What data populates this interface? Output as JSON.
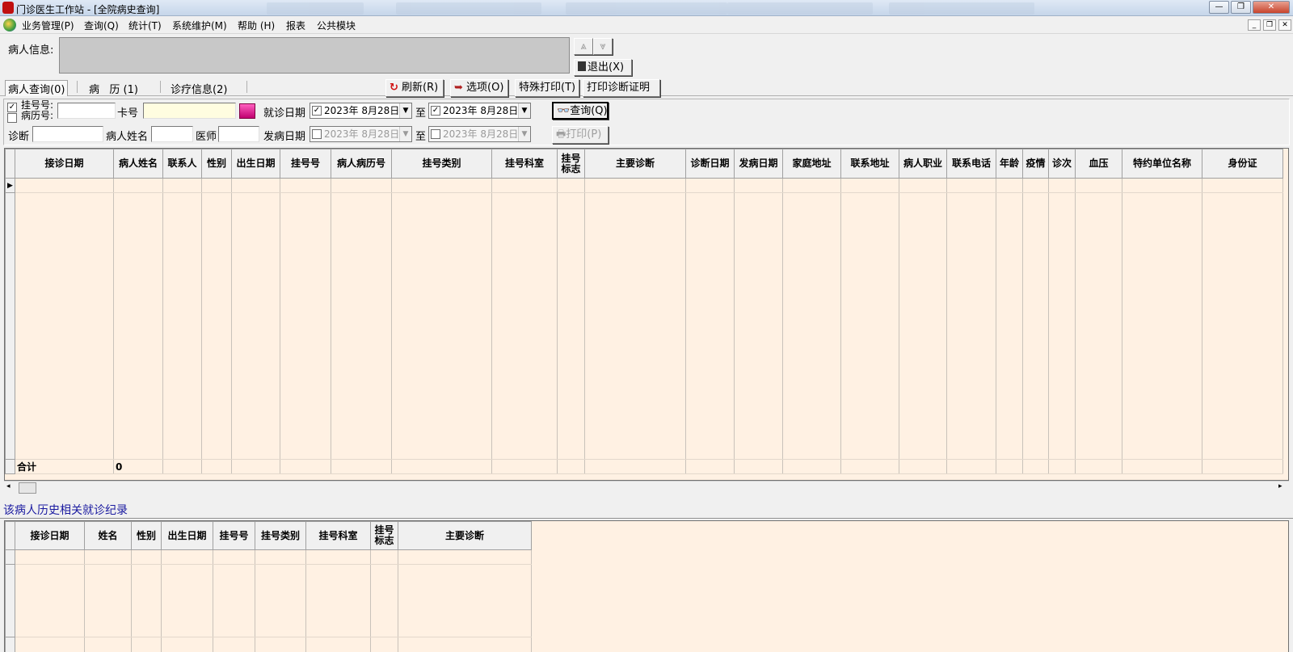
{
  "window": {
    "title": "门诊医生工作站 - [全院病史查询]"
  },
  "menu": [
    "业务管理(P)",
    "查询(Q)",
    "统计(T)",
    "系统维护(M)",
    "帮助 (H)",
    "报表",
    "公共模块"
  ],
  "patient_info": {
    "label": "病人信息:",
    "exit_label": "退出(X)"
  },
  "tabs": [
    "病人查询(0)",
    "病   历 (1)",
    "诊疗信息(2)"
  ],
  "toolbar": {
    "refresh": "刷新(R)",
    "options": "选项(O)",
    "special_print": "特殊打印(T)",
    "print_cert": "打印诊断证明"
  },
  "filters": {
    "reg_no_label": "挂号号:",
    "record_no_label": "病历号:",
    "card_label": "卡号",
    "visit_date_label": "就诊日期",
    "visit_from": "2023年  8月28日",
    "to_label": "至",
    "visit_to": "2023年  8月28日",
    "diagnosis_label": "诊断",
    "name_label": "病人姓名",
    "doctor_label": "医师",
    "onset_date_label": "发病日期",
    "onset_from": "2023年  8月28日",
    "onset_to": "2023年  8月28日",
    "query_label": "查询(Q)",
    "print_label": "打印(P)"
  },
  "main_table": {
    "columns": [
      "接诊日期",
      "病人姓名",
      "联系人",
      "性别",
      "出生日期",
      "挂号号",
      "病人病历号",
      "挂号类别",
      "挂号科室",
      "挂号标志",
      "主要诊断",
      "诊断日期",
      "发病日期",
      "家庭地址",
      "联系地址",
      "病人职业",
      "联系电话",
      "年龄",
      "疫情",
      "诊次",
      "血压",
      "特约单位名称",
      "身份证"
    ],
    "total_label": "合计",
    "total_value": "0"
  },
  "history": {
    "title": "该病人历史相关就诊纪录",
    "columns": [
      "接诊日期",
      "姓名",
      "性别",
      "出生日期",
      "挂号号",
      "挂号类别",
      "挂号科室",
      "挂号标志",
      "主要诊断"
    ]
  }
}
